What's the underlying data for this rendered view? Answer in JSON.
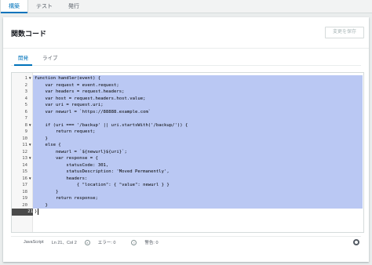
{
  "top_tabs": [
    "構築",
    "テスト",
    "発行"
  ],
  "panel": {
    "title": "関数コード",
    "save_label": "変更を保存"
  },
  "sub_tabs": [
    "開発",
    "ライブ"
  ],
  "code_lines": [
    {
      "n": "1",
      "fold": true,
      "text": "function handler(event) {"
    },
    {
      "n": "2",
      "fold": false,
      "text": "    var request = event.request;"
    },
    {
      "n": "3",
      "fold": false,
      "text": "    var headers = request.headers;"
    },
    {
      "n": "4",
      "fold": false,
      "text": "    var host = request.headers.host.value;"
    },
    {
      "n": "5",
      "fold": false,
      "text": "    var uri = request.uri;"
    },
    {
      "n": "6",
      "fold": false,
      "text": "    var newurl = `https://88888.example.com`"
    },
    {
      "n": "7",
      "fold": false,
      "text": ""
    },
    {
      "n": "8",
      "fold": true,
      "text": "    if (uri === '/backup' || uri.startsWith('/backup/')) {"
    },
    {
      "n": "9",
      "fold": false,
      "text": "        return request;"
    },
    {
      "n": "10",
      "fold": false,
      "text": "    }"
    },
    {
      "n": "11",
      "fold": true,
      "text": "    else {"
    },
    {
      "n": "12",
      "fold": false,
      "text": "        newurl = `${newurl}${uri}`;"
    },
    {
      "n": "13",
      "fold": true,
      "text": "        var response = {"
    },
    {
      "n": "14",
      "fold": false,
      "text": "            statusCode: 301,"
    },
    {
      "n": "15",
      "fold": false,
      "text": "            statusDescription: 'Moved Permanently',"
    },
    {
      "n": "16",
      "fold": true,
      "text": "            headers:"
    },
    {
      "n": "17",
      "fold": false,
      "text": "                { \"location\": { \"value\": newurl } }"
    },
    {
      "n": "18",
      "fold": false,
      "text": "        }"
    },
    {
      "n": "19",
      "fold": false,
      "text": "        return response;"
    },
    {
      "n": "20",
      "fold": false,
      "text": "    }"
    },
    {
      "n": "21",
      "fold": false,
      "text": "}"
    }
  ],
  "active_line": "21",
  "status": {
    "language": "JavaScript",
    "position": "Ln 21、Col 2",
    "errors": "エラー: 0",
    "warnings": "警告: 0"
  }
}
